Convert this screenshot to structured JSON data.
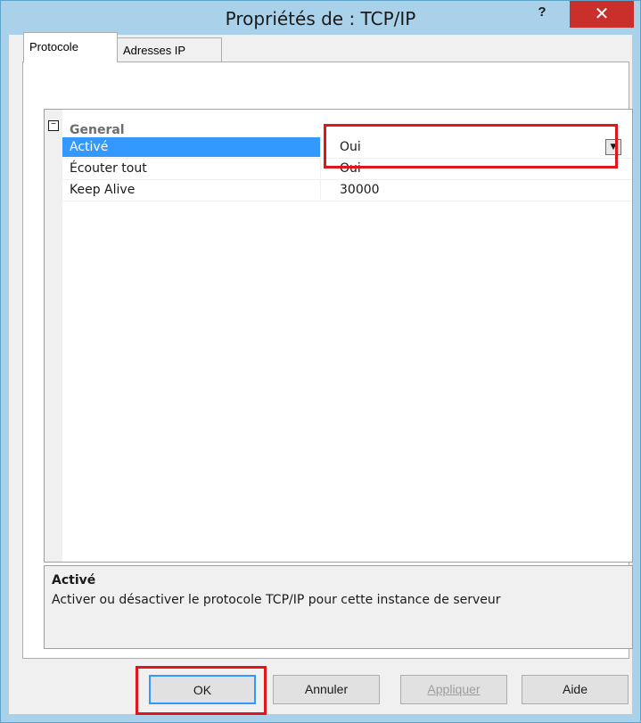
{
  "window": {
    "title": "Propriétés de : TCP/IP",
    "help_label": "?",
    "close_label": "✕"
  },
  "tabs": [
    {
      "label": "Protocole",
      "active": true
    },
    {
      "label": "Adresses IP",
      "active": false
    }
  ],
  "property_grid": {
    "category": {
      "expand_symbol": "⊟",
      "label": "General"
    },
    "rows": [
      {
        "name": "Activé",
        "value": "Oui",
        "selected": true,
        "has_dropdown": true
      },
      {
        "name": "Écouter tout",
        "value": "Oui",
        "selected": false
      },
      {
        "name": "Keep Alive",
        "value": "30000",
        "selected": false
      }
    ],
    "dropdown_icon": "▼"
  },
  "description": {
    "title": "Activé",
    "text": "Activer ou désactiver le protocole TCP/IP pour cette instance de serveur"
  },
  "buttons": {
    "ok": "OK",
    "cancel": "Annuler",
    "apply": "Appliquer",
    "help": "Aide"
  },
  "colors": {
    "selection": "#3399ff",
    "highlight": "#e0161b",
    "close": "#c9302c"
  }
}
